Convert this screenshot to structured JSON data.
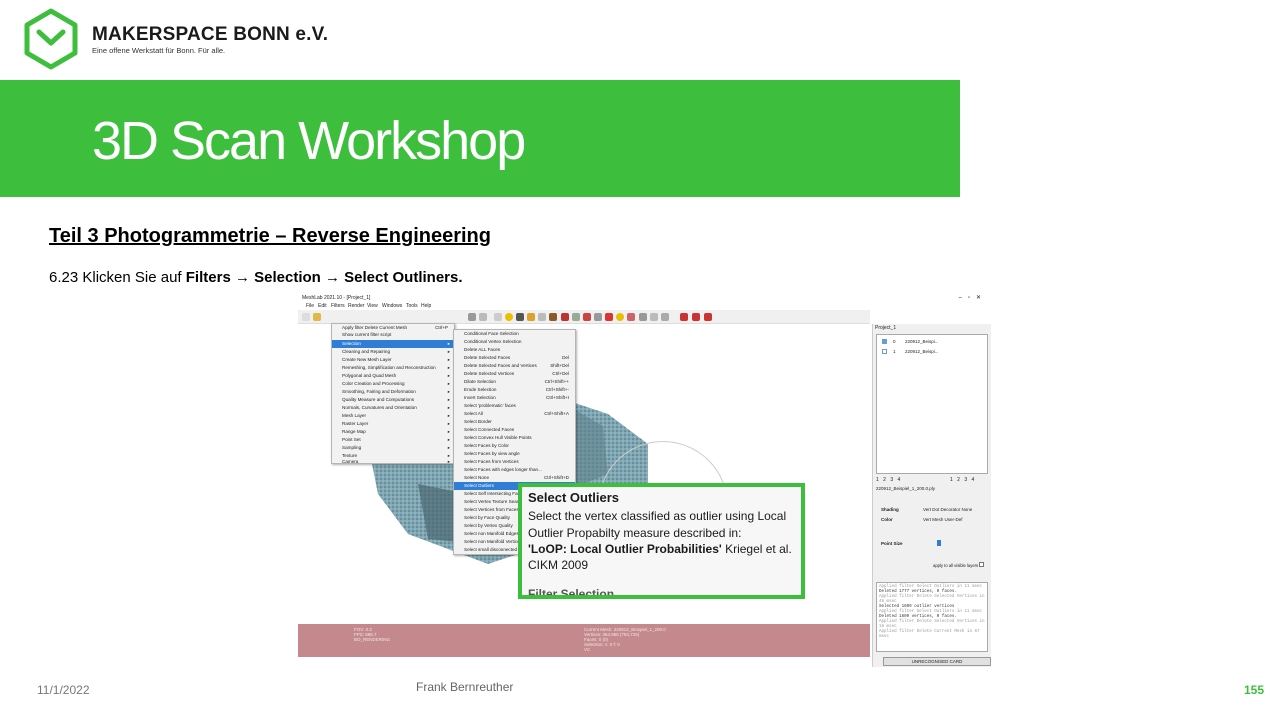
{
  "header": {
    "org_name": "MAKERSPACE BONN e.V.",
    "org_subtitle": "Eine offene Werkstatt für Bonn. Für alle.",
    "brand_color": "#3dbf3d",
    "title": "3D Scan Workshop"
  },
  "content": {
    "section_title": "Teil 3  Photogrammetrie  – Reverse Engineering",
    "step_prefix": "6.23 Klicken Sie auf ",
    "step_filters": "Filters",
    "step_arrow": "→",
    "step_selection": "Selection",
    "step_outliers": "Select Outliners."
  },
  "screenshot": {
    "window_title": "MeshLab 2021.10 - [Project_1]",
    "menu": [
      "File",
      "Edit",
      "Filters",
      "Render",
      "View",
      "Windows",
      "Tools",
      "Help"
    ],
    "filters_menu": [
      {
        "label": "Apply filter Delete Current Mesh",
        "shortcut": "Ctrl+P"
      },
      {
        "label": "Show current filter script",
        "shortcut": ""
      },
      {
        "label": "Selection",
        "shortcut": ""
      },
      {
        "label": "Cleaning and Repairing",
        "shortcut": ""
      },
      {
        "label": "Create New Mesh Layer",
        "shortcut": ""
      },
      {
        "label": "Remeshing, Simplification and Reconstruction",
        "shortcut": ""
      },
      {
        "label": "Polygonal and Quad Mesh",
        "shortcut": ""
      },
      {
        "label": "Color Creation and Processing",
        "shortcut": ""
      },
      {
        "label": "Smoothing, Fairing and Deformation",
        "shortcut": ""
      },
      {
        "label": "Quality Measure and Computations",
        "shortcut": ""
      },
      {
        "label": "Normals, Curvatures and Orientation",
        "shortcut": ""
      },
      {
        "label": "Mesh Layer",
        "shortcut": ""
      },
      {
        "label": "Raster Layer",
        "shortcut": ""
      },
      {
        "label": "Range Map",
        "shortcut": ""
      },
      {
        "label": "Point Set",
        "shortcut": ""
      },
      {
        "label": "Sampling",
        "shortcut": ""
      },
      {
        "label": "Texture",
        "shortcut": ""
      },
      {
        "label": "Camera",
        "shortcut": ""
      },
      {
        "label": "Other",
        "shortcut": ""
      }
    ],
    "selection_menu": [
      {
        "label": "Conditional Face Selection",
        "shortcut": ""
      },
      {
        "label": "Conditional Vertex Selection",
        "shortcut": ""
      },
      {
        "label": "Delete ALL Faces",
        "shortcut": ""
      },
      {
        "label": "Delete Selected Faces",
        "shortcut": "Del"
      },
      {
        "label": "Delete Selected Faces and Vertices",
        "shortcut": "Shift+Del"
      },
      {
        "label": "Delete Selected Vertices",
        "shortcut": "Ctrl+Del"
      },
      {
        "label": "Dilate Selection",
        "shortcut": "Ctrl+Shift++"
      },
      {
        "label": "Erode Selection",
        "shortcut": "Ctrl+Shift+-"
      },
      {
        "label": "Invert Selection",
        "shortcut": "Ctrl+Shift+I"
      },
      {
        "label": "Select 'problematic' faces",
        "shortcut": ""
      },
      {
        "label": "Select All",
        "shortcut": "Ctrl+Shift+A"
      },
      {
        "label": "Select Border",
        "shortcut": ""
      },
      {
        "label": "Select Connected Faces",
        "shortcut": ""
      },
      {
        "label": "Select Convex Hull Visible Points",
        "shortcut": ""
      },
      {
        "label": "Select Faces by Color",
        "shortcut": ""
      },
      {
        "label": "Select Faces by view angle",
        "shortcut": ""
      },
      {
        "label": "Select Faces from Vertices",
        "shortcut": ""
      },
      {
        "label": "Select Faces with edges longer than...",
        "shortcut": ""
      },
      {
        "label": "Select None",
        "shortcut": "Ctrl+Shift+D"
      },
      {
        "label": "Select Outliers",
        "shortcut": ""
      },
      {
        "label": "Select Self Intersecting Faces",
        "shortcut": ""
      },
      {
        "label": "Select Vertex Texture Seams",
        "shortcut": ""
      },
      {
        "label": "Select Vertices from Faces",
        "shortcut": ""
      },
      {
        "label": "Select by Face Quality",
        "shortcut": ""
      },
      {
        "label": "Select by Vertex Quality",
        "shortcut": ""
      },
      {
        "label": "Select non Manifold Edges",
        "shortcut": ""
      },
      {
        "label": "Select non Manifold Vertices",
        "shortcut": ""
      },
      {
        "label": "Select small disconnected c...",
        "shortcut": ""
      }
    ],
    "layers_title": "Project_1",
    "layers": [
      {
        "id": "0",
        "name": "220912_Beispi..."
      },
      {
        "id": "1",
        "name": "220912_Beispi..."
      }
    ],
    "tabs_left": "1  2  3  4",
    "tabs_right": "1  2  3  4",
    "file_label": "220912_Beispiel_1_200.0.ply",
    "shading_label": "Shading",
    "shading_opts": "Vert  Dot Decorator  None",
    "color_label": "Color",
    "color_opts": "Vert  Mesh  User-Def",
    "point_size_label": "Point Size",
    "apply_all_label": "apply to all visible layers",
    "log": [
      "Applied filter Select Outliers in 11 msec",
      "Deleted 1777 vertices, 0 faces.",
      "Applied filter Delete Selected Vertices in 48 msec",
      "Selected 1609 outlier vertices",
      "Applied filter Select Outliers in 11 msec",
      "Deleted 1609 vertices, 0 faces.",
      "Applied filter Delete Selected Vertices in 16 msec",
      "Applied filter Delete Current Mesh in 67 msec"
    ],
    "bottom_button": "UNRECOGNISED CARD",
    "info_left": [
      "FOV: 0.2",
      "FPS: 698.7",
      "BO_RENDERING"
    ],
    "info_right": [
      "Current Mesh: 220912_Beispiel_1_200.0",
      "Vertices: 364,965   (784,725)",
      "Faces: 0   (0)",
      "Selection: v: 0 f: 0",
      "VC"
    ]
  },
  "tooltip": {
    "title": "Select Outliers",
    "line1": "Select the vertex classified as outlier using Local",
    "line2": "Outlier Propabilty measure described in:",
    "line3_bold": "'LoOP: Local Outlier Probabilities'",
    "line3_rest": " Kriegel et al.",
    "line4": "CIKM 2009",
    "cut_off": "Filter Selection"
  },
  "footer": {
    "date": "11/1/2022",
    "author": "Frank Bernreuther",
    "page": "155"
  }
}
